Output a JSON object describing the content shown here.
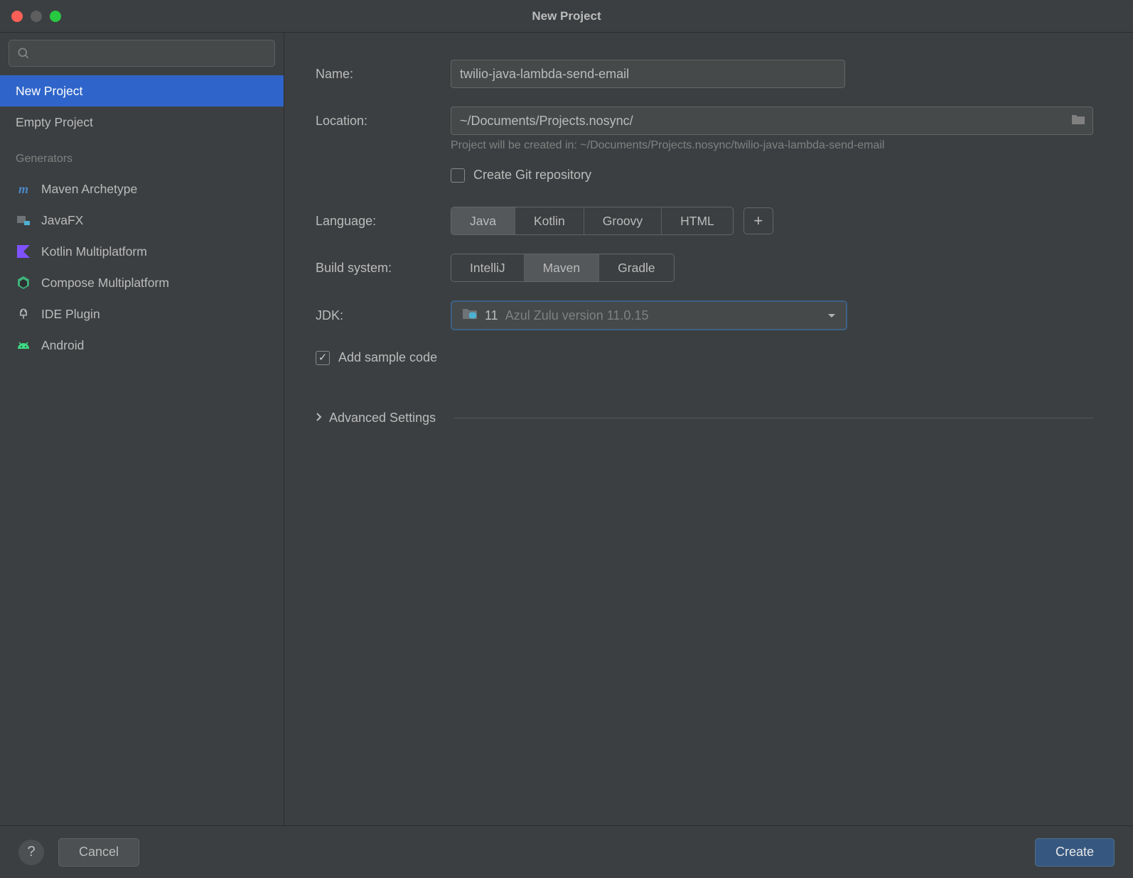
{
  "window": {
    "title": "New Project"
  },
  "sidebar": {
    "items": [
      {
        "label": "New Project"
      },
      {
        "label": "Empty Project"
      }
    ],
    "generators_header": "Generators",
    "generators": [
      {
        "label": "Maven Archetype"
      },
      {
        "label": "JavaFX"
      },
      {
        "label": "Kotlin Multiplatform"
      },
      {
        "label": "Compose Multiplatform"
      },
      {
        "label": "IDE Plugin"
      },
      {
        "label": "Android"
      }
    ]
  },
  "form": {
    "name_label": "Name:",
    "name_value": "twilio-java-lambda-send-email",
    "location_label": "Location:",
    "location_value": "~/Documents/Projects.nosync/",
    "location_hint": "Project will be created in: ~/Documents/Projects.nosync/twilio-java-lambda-send-email",
    "git_label": "Create Git repository",
    "language_label": "Language:",
    "languages": [
      "Java",
      "Kotlin",
      "Groovy",
      "HTML"
    ],
    "plus": "+",
    "build_label": "Build system:",
    "build_systems": [
      "IntelliJ",
      "Maven",
      "Gradle"
    ],
    "jdk_label": "JDK:",
    "jdk_primary": "11",
    "jdk_secondary": "Azul Zulu version 11.0.15",
    "sample_label": "Add sample code",
    "advanced_label": "Advanced Settings"
  },
  "footer": {
    "help": "?",
    "cancel": "Cancel",
    "create": "Create"
  }
}
